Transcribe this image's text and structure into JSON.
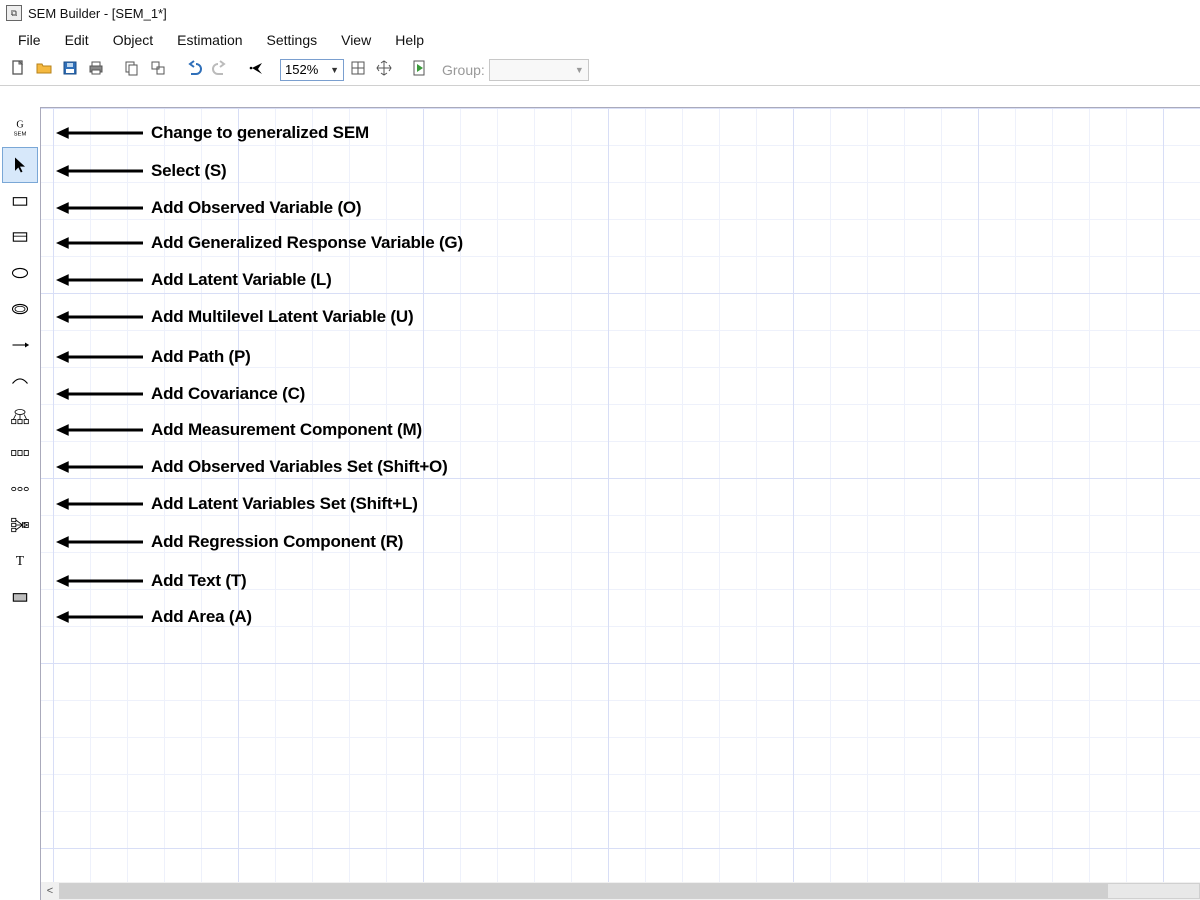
{
  "title": "SEM Builder - [SEM_1*]",
  "menu": [
    "File",
    "Edit",
    "Object",
    "Estimation",
    "Settings",
    "View",
    "Help"
  ],
  "toolbar": {
    "zoom": "152%",
    "group_label": "Group:"
  },
  "left_tools": [
    {
      "name": "gsem-mode-tool",
      "ann": "Change to generalized SEM"
    },
    {
      "name": "select-tool",
      "ann": "Select (S)"
    },
    {
      "name": "observed-variable-tool",
      "ann": "Add Observed Variable (O)"
    },
    {
      "name": "generalized-response-tool",
      "ann": "Add Generalized Response Variable (G)"
    },
    {
      "name": "latent-variable-tool",
      "ann": "Add Latent Variable (L)"
    },
    {
      "name": "multilevel-latent-tool",
      "ann": "Add Multilevel Latent Variable (U)"
    },
    {
      "name": "path-tool",
      "ann": "Add Path (P)"
    },
    {
      "name": "covariance-tool",
      "ann": "Add Covariance (C)"
    },
    {
      "name": "measurement-component-tool",
      "ann": "Add Measurement Component (M)"
    },
    {
      "name": "observed-set-tool",
      "ann": "Add Observed Variables Set (Shift+O)"
    },
    {
      "name": "latent-set-tool",
      "ann": "Add Latent Variables Set (Shift+L)"
    },
    {
      "name": "regression-component-tool",
      "ann": "Add Regression Component (R)"
    },
    {
      "name": "text-tool",
      "ann": "Add Text (T)"
    },
    {
      "name": "area-tool",
      "ann": "Add Area (A)"
    }
  ]
}
